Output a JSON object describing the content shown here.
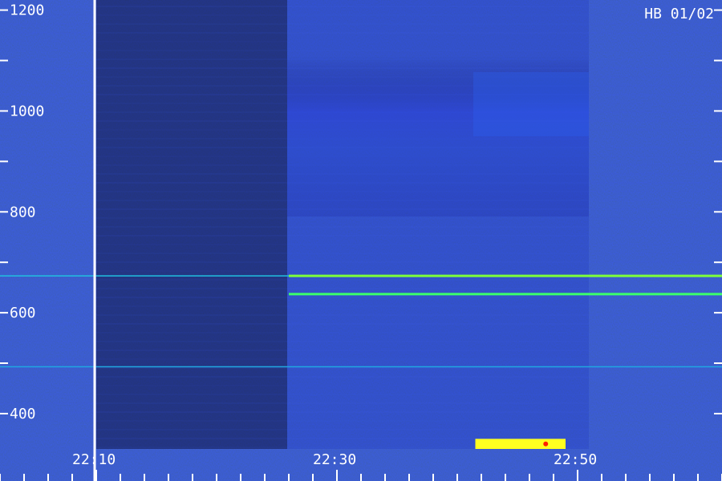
{
  "chart_data": {
    "type": "heatmap",
    "title": "HB 01/02",
    "xlabel": "",
    "ylabel": "",
    "y_tick_labels": [
      "400",
      "600",
      "800",
      "1000",
      "1200"
    ],
    "y_ticks": [
      400,
      600,
      800,
      1000,
      1200
    ],
    "ylim": [
      330,
      1220
    ],
    "x_tick_labels": [
      "22:10",
      "22:30",
      "22:50"
    ],
    "x_ticks_minutes": [
      10,
      30,
      50
    ],
    "xlim_minutes": [
      2,
      62
    ],
    "colormap": [
      "#000040",
      "#1a10b0",
      "#2a4ff0",
      "#20c8f0",
      "#40ff60",
      "#ffff00",
      "#ff2000"
    ],
    "lines": [
      {
        "y": 673,
        "x_start": 26,
        "x_end": 62,
        "intensity": "high",
        "color": "#7dff3a"
      },
      {
        "y": 637,
        "x_start": 26,
        "x_end": 62,
        "intensity": "high",
        "color": "#3cff6a"
      },
      {
        "y": 673,
        "x_start": 2,
        "x_end": 26,
        "intensity": "medium",
        "color": "#20c0e0"
      },
      {
        "y": 493,
        "x_start": 2,
        "x_end": 62,
        "intensity": "medium",
        "color": "#20a8e0"
      }
    ],
    "bright_regions": [
      {
        "x_start": 41.5,
        "x_end": 49,
        "y_start": 330,
        "y_end": 350,
        "color": "#ffff20"
      }
    ]
  }
}
